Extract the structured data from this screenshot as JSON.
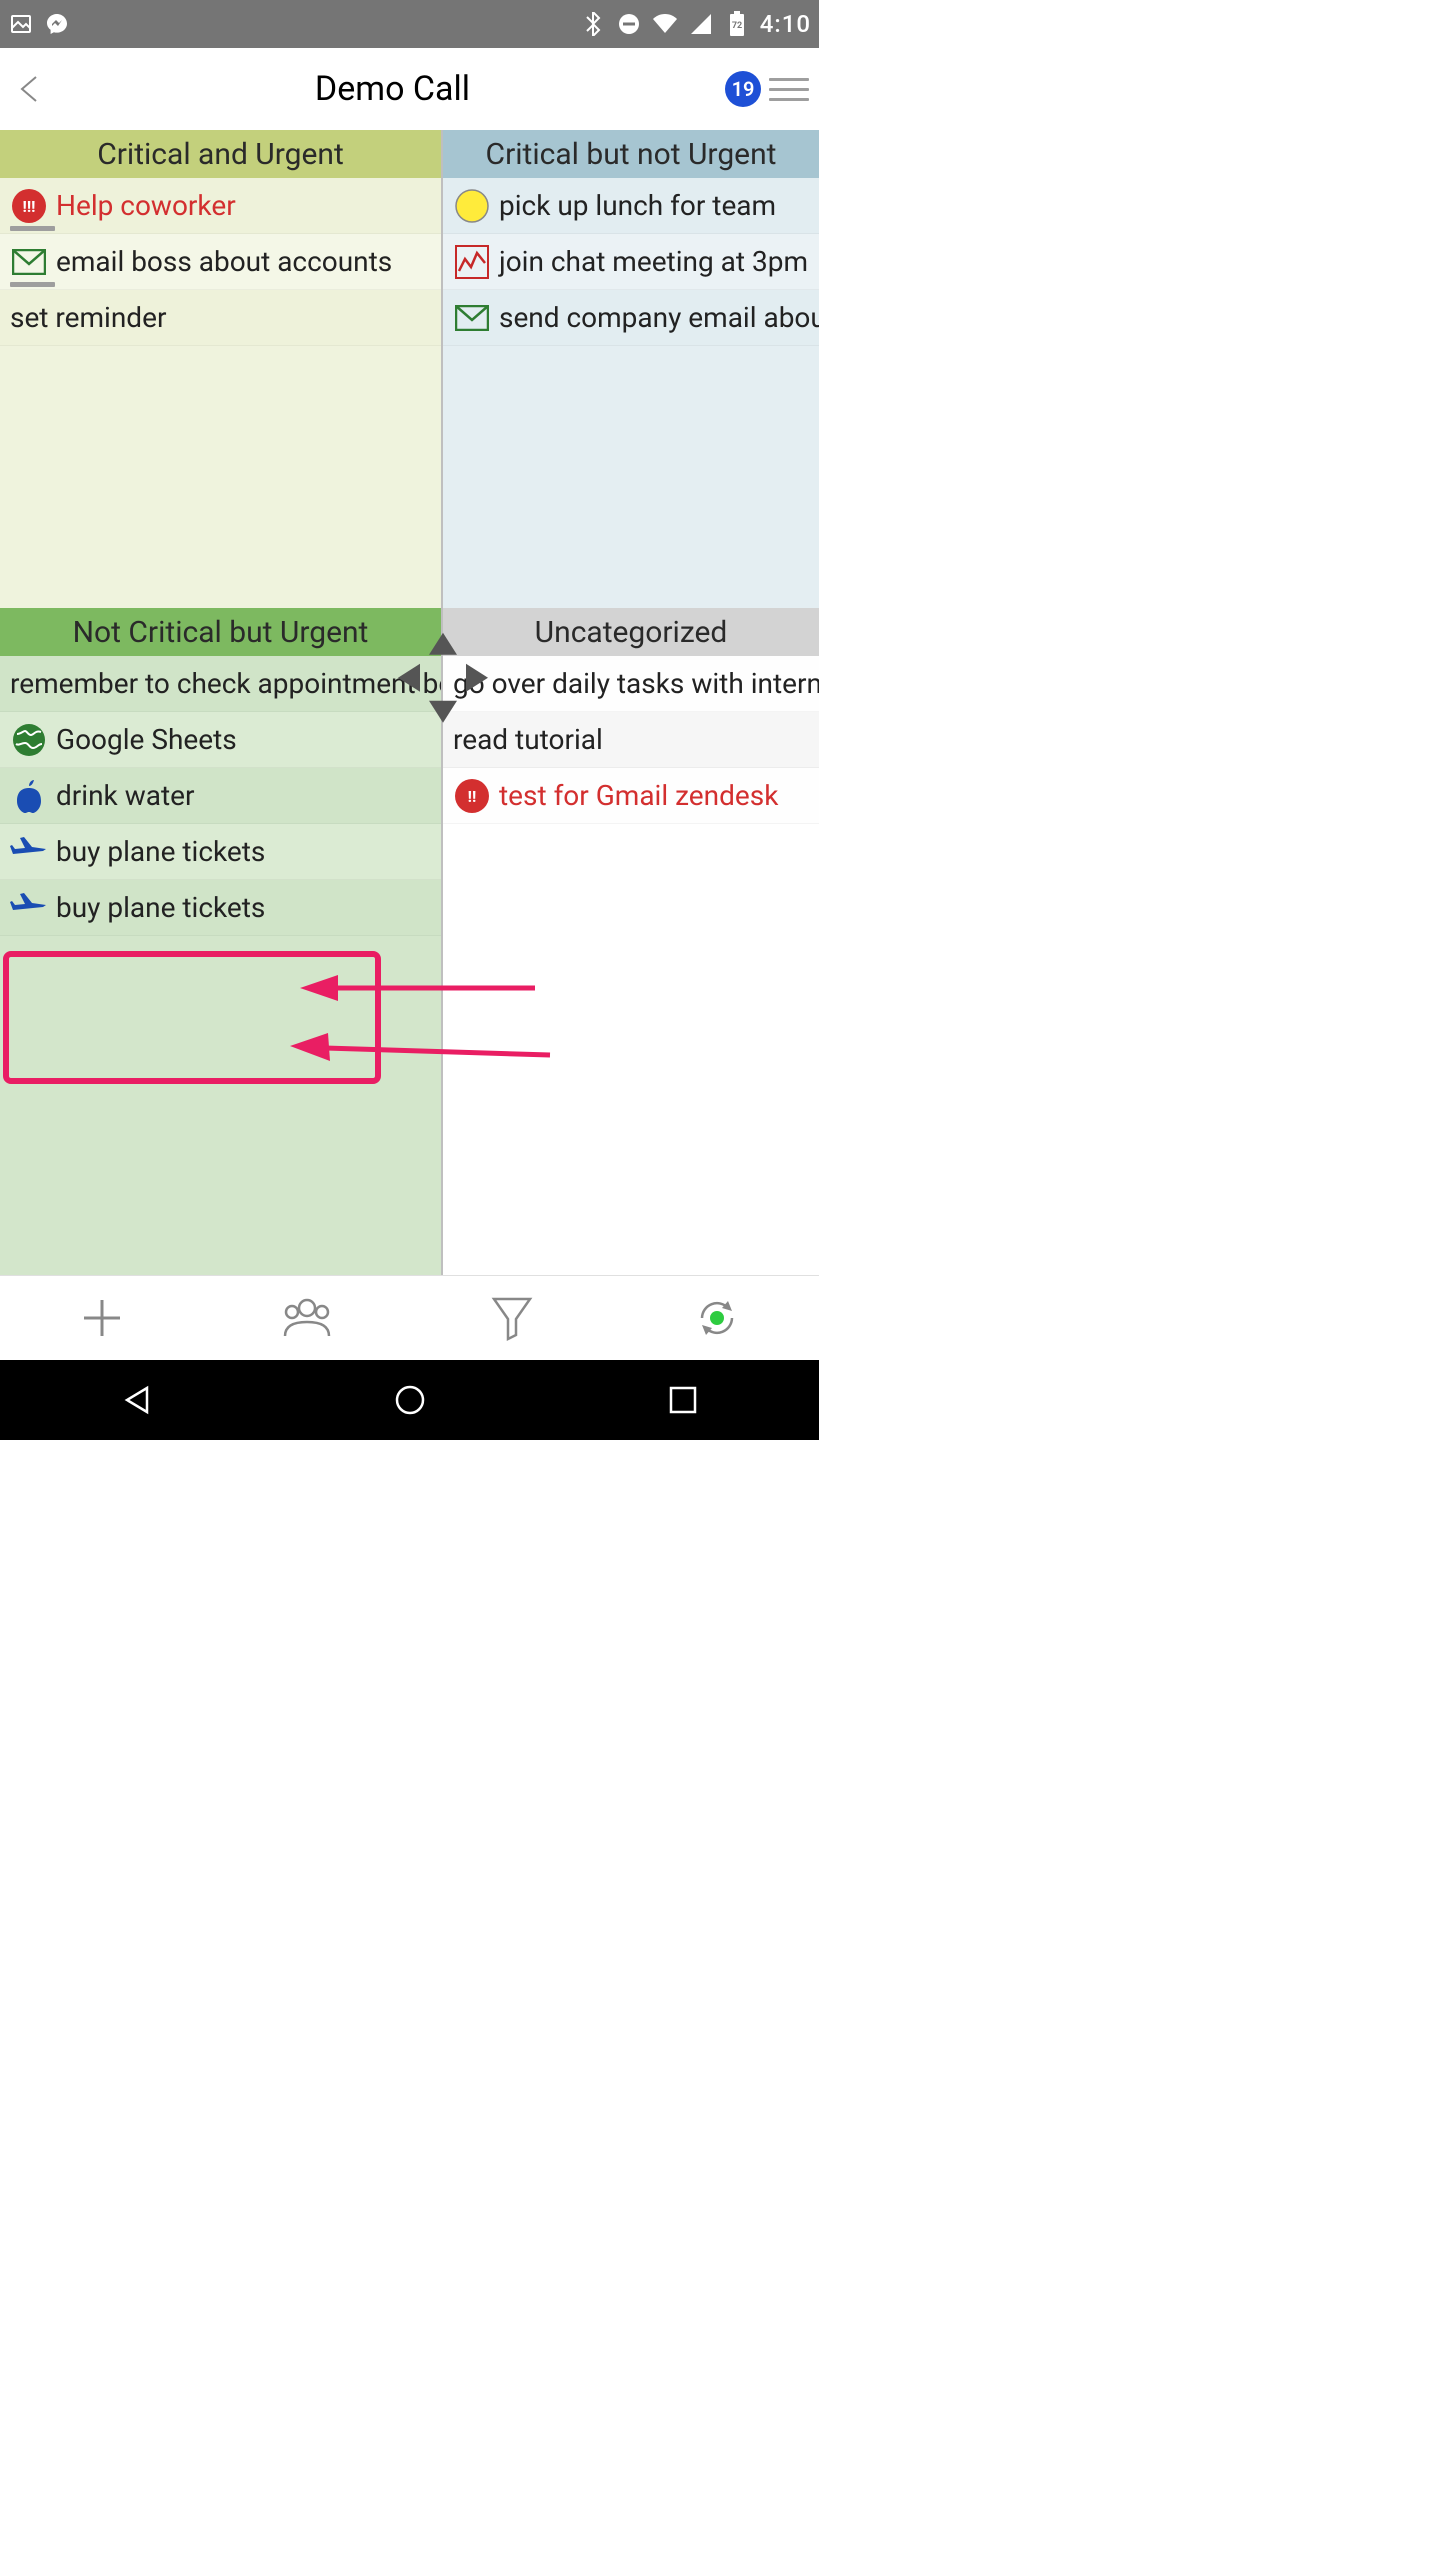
{
  "status": {
    "time": "4:10",
    "battery": "72"
  },
  "header": {
    "title": "Demo Call",
    "badge": "19"
  },
  "quadrants": {
    "q1": {
      "title": "Critical and Urgent",
      "tasks": [
        {
          "icon": "alert-red",
          "label": "Help coworker",
          "red": true,
          "progress": 0.22
        },
        {
          "icon": "mail-green",
          "label": "email boss about accounts",
          "progress": 0.22
        },
        {
          "icon": "",
          "label": "set reminder"
        }
      ]
    },
    "q2": {
      "title": "Critical but not Urgent",
      "tasks": [
        {
          "icon": "dot-yellow",
          "label": "pick up lunch for team"
        },
        {
          "icon": "chart-red",
          "label": "join chat meeting at 3pm"
        },
        {
          "icon": "mail-green",
          "label": "send company email about"
        }
      ]
    },
    "q3": {
      "title": "Not Critical but Urgent",
      "tasks": [
        {
          "icon": "",
          "label": "remember to check appointment bo"
        },
        {
          "icon": "globe-green",
          "label": "Google Sheets"
        },
        {
          "icon": "apple-blue",
          "label": "drink water"
        },
        {
          "icon": "plane-blue",
          "label": "buy plane tickets"
        },
        {
          "icon": "plane-blue",
          "label": "buy plane tickets"
        }
      ]
    },
    "q4": {
      "title": "Uncategorized",
      "tasks": [
        {
          "icon": "",
          "label": "go over daily tasks with intern"
        },
        {
          "icon": "",
          "label": "read tutorial"
        },
        {
          "icon": "alert-red-sm",
          "label": "test for Gmail zendesk",
          "red": true
        }
      ]
    }
  }
}
